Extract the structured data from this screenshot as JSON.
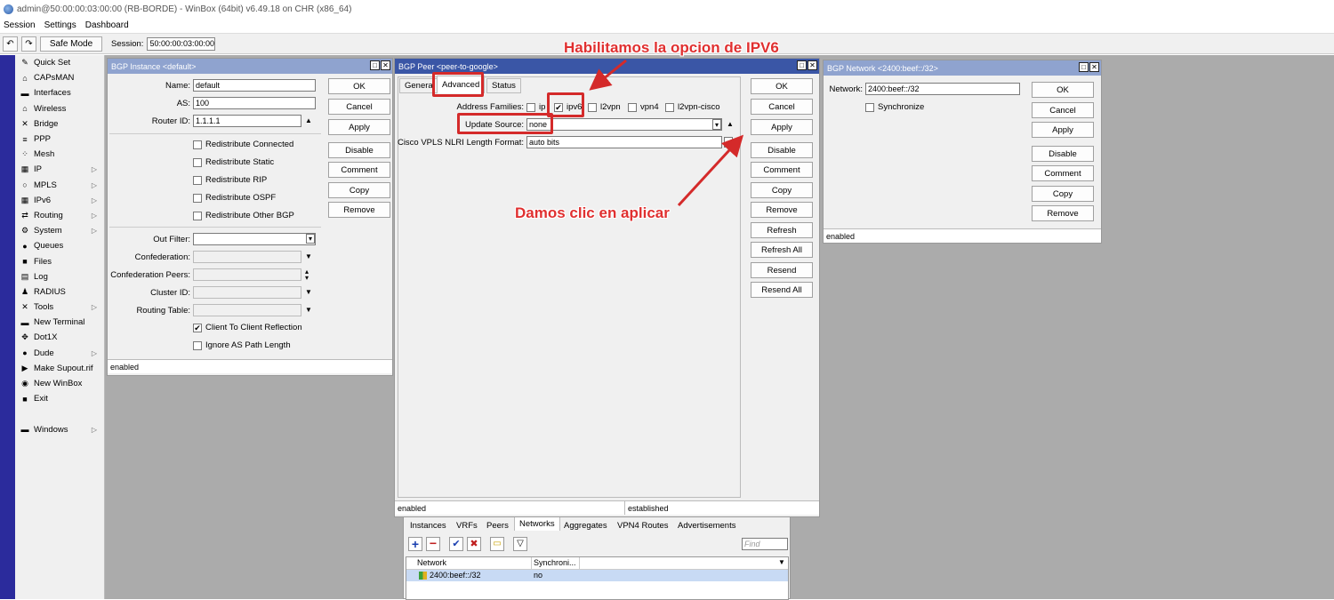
{
  "window_title": "admin@50:00:00:03:00:00 (RB-BORDE) - WinBox (64bit) v6.49.18 on CHR (x86_64)",
  "menu": [
    "Session",
    "Settings",
    "Dashboard"
  ],
  "toolbar": {
    "undo": "↶",
    "redo": "↷",
    "safe_mode": "Safe Mode",
    "session_label": "Session:",
    "session_value": "50:00:00:03:00:00"
  },
  "sidebar": [
    {
      "label": "Quick Set",
      "icon": "✎",
      "arrow": ""
    },
    {
      "label": "CAPsMAN",
      "icon": "⌂",
      "arrow": ""
    },
    {
      "label": "Interfaces",
      "icon": "▬",
      "arrow": ""
    },
    {
      "label": "Wireless",
      "icon": "⌂",
      "arrow": ""
    },
    {
      "label": "Bridge",
      "icon": "✕",
      "arrow": ""
    },
    {
      "label": "PPP",
      "icon": "≡",
      "arrow": ""
    },
    {
      "label": "Mesh",
      "icon": "⁘",
      "arrow": ""
    },
    {
      "label": "IP",
      "icon": "▦",
      "arrow": "▷"
    },
    {
      "label": "MPLS",
      "icon": "○",
      "arrow": "▷"
    },
    {
      "label": "IPv6",
      "icon": "▦",
      "arrow": "▷"
    },
    {
      "label": "Routing",
      "icon": "⇄",
      "arrow": "▷"
    },
    {
      "label": "System",
      "icon": "⚙",
      "arrow": "▷"
    },
    {
      "label": "Queues",
      "icon": "●",
      "arrow": ""
    },
    {
      "label": "Files",
      "icon": "■",
      "arrow": ""
    },
    {
      "label": "Log",
      "icon": "▤",
      "arrow": ""
    },
    {
      "label": "RADIUS",
      "icon": "♟",
      "arrow": ""
    },
    {
      "label": "Tools",
      "icon": "✕",
      "arrow": "▷"
    },
    {
      "label": "New Terminal",
      "icon": "▬",
      "arrow": ""
    },
    {
      "label": "Dot1X",
      "icon": "✥",
      "arrow": ""
    },
    {
      "label": "Dude",
      "icon": "●",
      "arrow": "▷"
    },
    {
      "label": "Make Supout.rif",
      "icon": "▶",
      "arrow": ""
    },
    {
      "label": "New WinBox",
      "icon": "◉",
      "arrow": ""
    },
    {
      "label": "Exit",
      "icon": "■",
      "arrow": ""
    },
    {
      "label": "",
      "icon": "",
      "arrow": ""
    },
    {
      "label": "Windows",
      "icon": "▬",
      "arrow": "▷"
    }
  ],
  "bgp_instance": {
    "title": "BGP Instance <default>",
    "labels": {
      "name": "Name:",
      "as": "AS:",
      "router_id": "Router ID:",
      "out_filter": "Out Filter:",
      "confederation": "Confederation:",
      "confed_peers": "Confederation Peers:",
      "cluster_id": "Cluster ID:",
      "routing_table": "Routing Table:"
    },
    "values": {
      "name": "default",
      "as": "100",
      "router_id": "1.1.1.1"
    },
    "checkboxes": [
      "Redistribute Connected",
      "Redistribute Static",
      "Redistribute RIP",
      "Redistribute OSPF",
      "Redistribute Other BGP"
    ],
    "checkboxes2": [
      {
        "label": "Client To Client Reflection",
        "checked": "✔"
      },
      {
        "label": "Ignore AS Path Length",
        "checked": ""
      }
    ],
    "buttons": [
      "OK",
      "Cancel",
      "Apply",
      "Disable",
      "Comment",
      "Copy",
      "Remove"
    ],
    "status": "enabled"
  },
  "bgp_peer": {
    "title": "BGP Peer <peer-to-google>",
    "tabs": [
      "General",
      "Advanced",
      "Status"
    ],
    "address_families_label": "Address Families:",
    "families": [
      {
        "label": "ip",
        "checked": ""
      },
      {
        "label": "ipv6",
        "checked": "✔"
      },
      {
        "label": "l2vpn",
        "checked": ""
      },
      {
        "label": "vpn4",
        "checked": ""
      },
      {
        "label": "l2vpn-cisco",
        "checked": ""
      }
    ],
    "update_source_label": "Update Source:",
    "update_source_value": "none",
    "cisco_label": "Cisco VPLS NLRI Length Format:",
    "cisco_value": "auto bits",
    "buttons": [
      "OK",
      "Cancel",
      "Apply",
      "Disable",
      "Comment",
      "Copy",
      "Remove",
      "Refresh",
      "Refresh All",
      "Resend",
      "Resend All"
    ],
    "status_left": "enabled",
    "status_right": "established"
  },
  "bgp_network": {
    "title": "BGP Network <2400:beef::/32>",
    "network_label": "Network:",
    "network_value": "2400:beef::/32",
    "synchronize": "Synchronize",
    "buttons": [
      "OK",
      "Cancel",
      "Apply",
      "Disable",
      "Comment",
      "Copy",
      "Remove"
    ],
    "status": "enabled"
  },
  "bgp_list": {
    "tabs": [
      "Instances",
      "VRFs",
      "Peers",
      "Networks",
      "Aggregates",
      "VPN4 Routes",
      "Advertisements"
    ],
    "find_placeholder": "Find",
    "columns": [
      "Network",
      "Synchroni..."
    ],
    "rows": [
      {
        "network": "2400:beef::/32",
        "sync": "no"
      }
    ]
  },
  "annotations": {
    "ipv6": "Habilitamos la opcion de IPV6",
    "apply": "Damos clic en aplicar"
  },
  "colors": {
    "annotation": "#e03030",
    "active_title": "#3a56a6",
    "inactive_title": "#8fa3cf",
    "left_strip": "#2b2b9c",
    "desktop": "#ababab"
  }
}
